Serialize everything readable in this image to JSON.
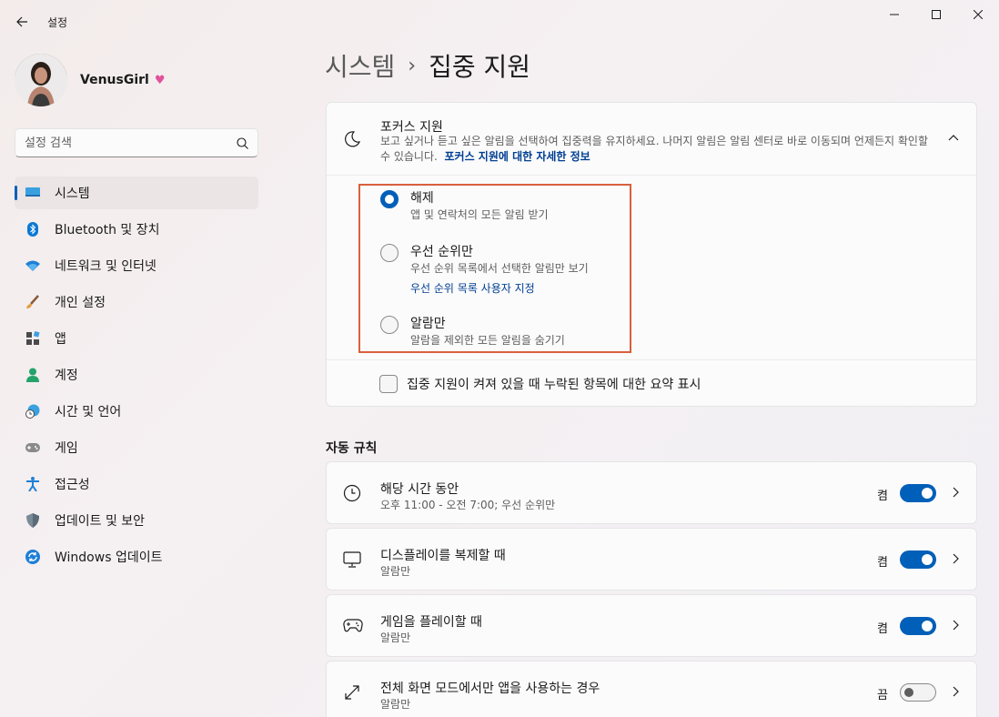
{
  "window": {
    "app_title": "설정"
  },
  "profile": {
    "name": "VenusGirl",
    "badge": "♥"
  },
  "search": {
    "placeholder": "설정 검색"
  },
  "sidebar": {
    "items": [
      {
        "label": "시스템",
        "icon": "system-icon",
        "active": true
      },
      {
        "label": "Bluetooth 및 장치",
        "icon": "bluetooth-icon"
      },
      {
        "label": "네트워크 및 인터넷",
        "icon": "wifi-icon"
      },
      {
        "label": "개인 설정",
        "icon": "brush-icon"
      },
      {
        "label": "앱",
        "icon": "apps-icon"
      },
      {
        "label": "계정",
        "icon": "account-icon"
      },
      {
        "label": "시간 및 언어",
        "icon": "time-language-icon"
      },
      {
        "label": "게임",
        "icon": "gaming-icon"
      },
      {
        "label": "접근성",
        "icon": "accessibility-icon"
      },
      {
        "label": "업데이트 및 보안",
        "icon": "shield-icon"
      },
      {
        "label": "Windows 업데이트",
        "icon": "windows-update-icon"
      }
    ]
  },
  "breadcrumb": {
    "parent": "시스템",
    "separator": "›",
    "current": "집중 지원"
  },
  "focus": {
    "title": "포커스 지원",
    "description": "보고 싶거나 듣고 싶은 알림을 선택하여 집중력을 유지하세요. 나머지 알림은 알림 센터로 바로 이동되며 언제든지 확인할 수 있습니다.",
    "link": "포커스 지원에 대한 자세한 정보",
    "options": [
      {
        "label": "해제",
        "sub": "앱 및 연락처의 모든 알림 받기",
        "checked": true
      },
      {
        "label": "우선 순위만",
        "sub": "우선 순위 목록에서 선택한 알림만 보기",
        "link": "우선 순위 목록 사용자 지정"
      },
      {
        "label": "알람만",
        "sub": "알람을 제외한 모든 알림을 숨기기"
      }
    ],
    "summary_label": "집중 지원이 켜져 있을 때 누락된 항목에 대한 요약 표시"
  },
  "rules": {
    "section_title": "자동 규칙",
    "items": [
      {
        "title": "해당 시간 동안",
        "sub": "오후 11:00 - 오전 7:00; 우선 순위만",
        "state": "켬",
        "on": true,
        "icon": "clock-icon"
      },
      {
        "title": "디스플레이를 복제할 때",
        "sub": "알람만",
        "state": "켬",
        "on": true,
        "icon": "monitor-icon"
      },
      {
        "title": "게임을 플레이할 때",
        "sub": "알람만",
        "state": "켬",
        "on": true,
        "icon": "gamepad-icon"
      },
      {
        "title": "전체 화면 모드에서만 앱을 사용하는 경우",
        "sub": "알람만",
        "state": "끔",
        "on": false,
        "icon": "fullscreen-icon"
      }
    ]
  },
  "colors": {
    "accent": "#005fb8",
    "highlight_border": "#d9603c",
    "link": "#003e92"
  }
}
